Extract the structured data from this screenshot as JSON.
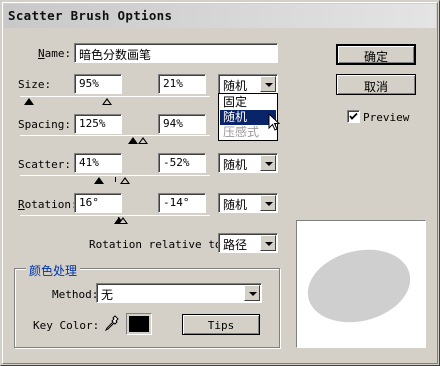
{
  "window": {
    "title": "Scatter Brush Options"
  },
  "name": {
    "label": "Name:",
    "value": "暗色分数画笔"
  },
  "size": {
    "label": "Size:",
    "min": "95%",
    "max": "21%",
    "mode": "随机",
    "min_level": 0.0,
    "max_level": 0.5
  },
  "spacing": {
    "label": "Spacing:",
    "min": "125%",
    "max": "94%",
    "min_level": 0.59,
    "max_level": 0.64
  },
  "scatter": {
    "label": "Scatter:",
    "min": "41%",
    "max": "-52%",
    "mode": "随机",
    "min_level": 0.48,
    "max_level": 0.54
  },
  "rotation": {
    "label": "Rotation:",
    "min": "16°",
    "max": "-14°",
    "mode": "随机",
    "min_level": 0.51,
    "max_level": 0.53
  },
  "rotation_relative": {
    "label": "Rotation relative to:",
    "value": "路径"
  },
  "colorization": {
    "group_title": "颜色处理",
    "method_label": "Method:",
    "method_value": "无",
    "key_color_label": "Key Color:",
    "key_color": "#000000",
    "tips_label": "Tips"
  },
  "buttons": {
    "ok": "确定",
    "cancel": "取消"
  },
  "preview": {
    "label": "Preview",
    "checked": true
  },
  "dropdown": {
    "options": [
      "固定",
      "随机",
      "压感式"
    ],
    "selected": "随机",
    "disabled": "压感式"
  },
  "colors": {
    "highlight": "#0a246a",
    "face": "#d4d0c8",
    "group_title": "#0033aa",
    "stroke_preview": "#cfcfcf"
  }
}
